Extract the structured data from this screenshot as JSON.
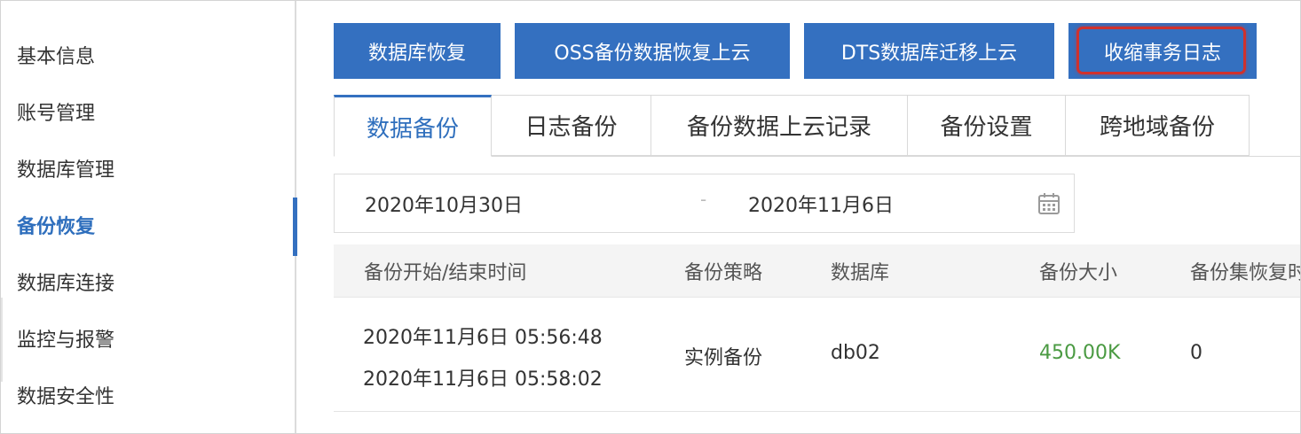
{
  "sidebar": {
    "items": [
      {
        "label": "基本信息"
      },
      {
        "label": "账号管理"
      },
      {
        "label": "数据库管理"
      },
      {
        "label": "备份恢复",
        "active": true
      },
      {
        "label": "数据库连接"
      },
      {
        "label": "监控与报警"
      },
      {
        "label": "数据安全性"
      }
    ]
  },
  "actions": {
    "db_restore": "数据库恢复",
    "oss_restore": "OSS备份数据恢复上云",
    "dts_migrate": "DTS数据库迁移上云",
    "shrink_log": "收缩事务日志"
  },
  "tabs": [
    {
      "label": "数据备份",
      "active": true
    },
    {
      "label": "日志备份"
    },
    {
      "label": "备份数据上云记录"
    },
    {
      "label": "备份设置"
    },
    {
      "label": "跨地域备份"
    }
  ],
  "date_range": {
    "start": "2020年10月30日",
    "separator": "-",
    "end": "2020年11月6日",
    "icon": "calendar-icon"
  },
  "table": {
    "columns": [
      "备份开始/结束时间",
      "备份策略",
      "数据库",
      "备份大小",
      "备份集恢复时"
    ],
    "rows": [
      {
        "start_time": "2020年11月6日 05:56:48",
        "end_time": "2020年11月6日 05:58:02",
        "strategy": "实例备份",
        "database": "db02",
        "size": "450.00K",
        "restore": "0"
      }
    ]
  },
  "colors": {
    "primary": "#3470c0",
    "active_text": "#2f6fbd",
    "highlight": "#d0312d",
    "size_green": "#4a9a42"
  }
}
